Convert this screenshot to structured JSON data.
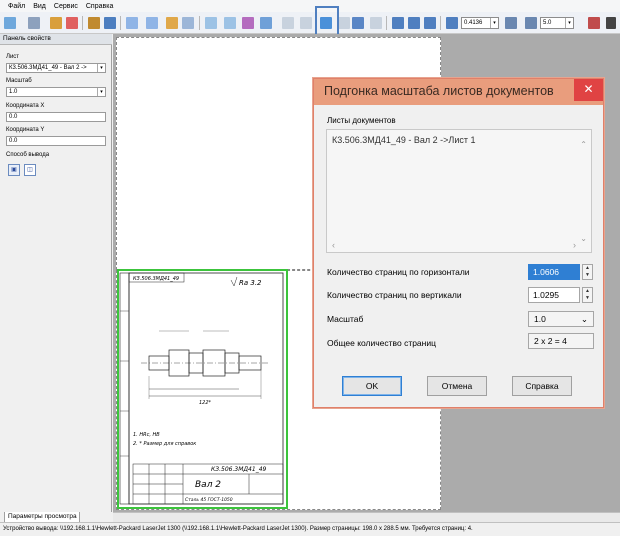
{
  "menu": [
    "Файл",
    "Вид",
    "Сервис",
    "Справка"
  ],
  "toolbar": {
    "zoom_value": "0.4136",
    "step_value": "5.0"
  },
  "panel": {
    "title": "Панель свойств",
    "sheet_label": "Лист",
    "sheet_value": "К3.506.3МД41_49 - Вал 2 ->",
    "scale_label": "Масштаб",
    "scale_value": "1.0",
    "x_label": "Координата X",
    "x_value": "0.0",
    "y_label": "Координата Y",
    "y_value": "0.0",
    "method_label": "Способ вывода",
    "tab_label": "Параметры просмотра"
  },
  "drawing": {
    "stamp_no": "КЗ.506.3МД41_49",
    "part_name": "Вал 2",
    "material": "Сталь 45 ГОСТ-1050",
    "roughness": "Ra 3.2",
    "note1": "1. HRc, HB",
    "note2": "2. * Размер для справок",
    "dim": "122*"
  },
  "dialog": {
    "title": "Подгонка масштаба листов документов",
    "close_glyph": "✕",
    "sheets_label": "Листы документов",
    "sheet_item": "К3.506.3МД41_49 - Вал 2 ->Лист 1",
    "horizontal_label": "Количество страниц по горизонтали",
    "horizontal_value": "1.0606",
    "vertical_label": "Количество страниц по вертикали",
    "vertical_value": "1.0295",
    "scale_label": "Масштаб",
    "scale_value": "1.0",
    "total_label": "Общее количество страниц",
    "total_value": "2 x 2 = 4",
    "ok_label": "OK",
    "cancel_label": "Отмена",
    "help_label": "Справка"
  },
  "status": "Устройство вывода: \\\\192.168.1.1\\Hewlett-Packard LaserJet 1300 (\\\\192.168.1.1\\Hewlett-Packard LaserJet 1300). Размер страницы: 198.0 x 288.5 мм. Требуется страниц: 4.",
  "colors": {
    "dialog_title_bg": "#e99d7d",
    "close_button": "#e04343",
    "selection_highlight": "#2f7fd3",
    "drawing_frame": "#3cc43c"
  }
}
